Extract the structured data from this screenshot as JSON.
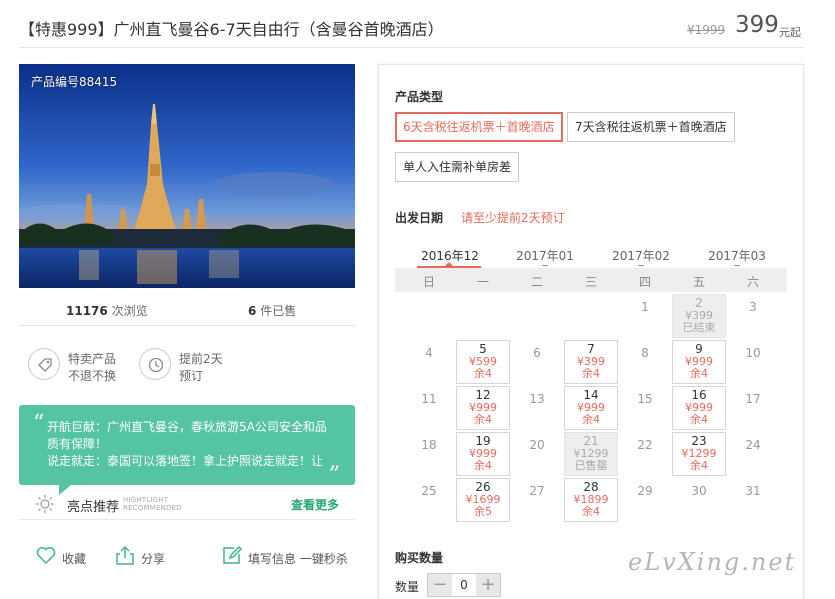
{
  "header": {
    "title": "【特惠999】广州直飞曼谷6-7天自由行（含曼谷首晚酒店）",
    "old_price": "¥1999",
    "price": "399",
    "price_unit": "元起"
  },
  "photo": {
    "product_code": "产品编号88415"
  },
  "stats": {
    "views_count": "11176",
    "views_label": "次浏览",
    "sold_count": "6",
    "sold_label": "件已售"
  },
  "features": [
    {
      "line1": "特卖产品",
      "line2": "不退不换",
      "icon": "tag-icon"
    },
    {
      "line1": "提前2天",
      "line2": "预订",
      "icon": "clock-icon"
    }
  ],
  "promo": {
    "line1": "开航巨献：广州直飞曼谷，春秋旅游5A公司安全和品",
    "line2": "质有保障！",
    "line3": "说走就走：泰国可以落地签！拿上护照说走就走！让"
  },
  "highlight": {
    "title": "亮点推荐",
    "sub1": "HIGHTLIGHT",
    "sub2": "RECOMMENDED",
    "more": "查看更多"
  },
  "actions": {
    "favorite": "收藏",
    "share": "分享",
    "fill_info": "填写信息 一键秒杀"
  },
  "product_type": {
    "title": "产品类型",
    "options": [
      {
        "label": "6天含税往返机票＋首晚酒店",
        "selected": true
      },
      {
        "label": "7天含税往返机票＋首晚酒店",
        "selected": false
      },
      {
        "label": "单人入住需补单房差",
        "selected": false
      }
    ]
  },
  "departure": {
    "title": "出发日期",
    "hint": "请至少提前2天预订",
    "months": [
      "2016年12",
      "2017年01",
      "2017年02",
      "2017年03"
    ],
    "active_month": 0,
    "weekdays": [
      "日",
      "一",
      "二",
      "三",
      "四",
      "五",
      "六"
    ],
    "days": [
      {
        "day": "1",
        "col": 4,
        "row": 0,
        "state": "plain"
      },
      {
        "day": "2",
        "col": 5,
        "row": 0,
        "state": "gone",
        "price": "¥399",
        "status": "已结束"
      },
      {
        "day": "3",
        "col": 6,
        "row": 0,
        "state": "plain"
      },
      {
        "day": "4",
        "col": 0,
        "row": 1,
        "state": "plain"
      },
      {
        "day": "5",
        "col": 1,
        "row": 1,
        "state": "avail",
        "price": "¥599",
        "status": "余4"
      },
      {
        "day": "6",
        "col": 2,
        "row": 1,
        "state": "plain"
      },
      {
        "day": "7",
        "col": 3,
        "row": 1,
        "state": "avail",
        "price": "¥399",
        "status": "余4"
      },
      {
        "day": "8",
        "col": 4,
        "row": 1,
        "state": "plain"
      },
      {
        "day": "9",
        "col": 5,
        "row": 1,
        "state": "avail",
        "price": "¥999",
        "status": "余4"
      },
      {
        "day": "10",
        "col": 6,
        "row": 1,
        "state": "plain"
      },
      {
        "day": "11",
        "col": 0,
        "row": 2,
        "state": "plain"
      },
      {
        "day": "12",
        "col": 1,
        "row": 2,
        "state": "avail",
        "price": "¥999",
        "status": "余4"
      },
      {
        "day": "13",
        "col": 2,
        "row": 2,
        "state": "plain"
      },
      {
        "day": "14",
        "col": 3,
        "row": 2,
        "state": "avail",
        "price": "¥999",
        "status": "余4"
      },
      {
        "day": "15",
        "col": 4,
        "row": 2,
        "state": "plain"
      },
      {
        "day": "16",
        "col": 5,
        "row": 2,
        "state": "avail",
        "price": "¥999",
        "status": "余4"
      },
      {
        "day": "17",
        "col": 6,
        "row": 2,
        "state": "plain"
      },
      {
        "day": "18",
        "col": 0,
        "row": 3,
        "state": "plain"
      },
      {
        "day": "19",
        "col": 1,
        "row": 3,
        "state": "avail",
        "price": "¥999",
        "status": "余4"
      },
      {
        "day": "20",
        "col": 2,
        "row": 3,
        "state": "plain"
      },
      {
        "day": "21",
        "col": 3,
        "row": 3,
        "state": "gone",
        "price": "¥1299",
        "status": "已售罄"
      },
      {
        "day": "22",
        "col": 4,
        "row": 3,
        "state": "plain"
      },
      {
        "day": "23",
        "col": 5,
        "row": 3,
        "state": "avail",
        "price": "¥1299",
        "status": "余4"
      },
      {
        "day": "24",
        "col": 6,
        "row": 3,
        "state": "plain"
      },
      {
        "day": "25",
        "col": 0,
        "row": 4,
        "state": "plain"
      },
      {
        "day": "26",
        "col": 1,
        "row": 4,
        "state": "avail",
        "price": "¥1699",
        "status": "余5"
      },
      {
        "day": "27",
        "col": 2,
        "row": 4,
        "state": "plain"
      },
      {
        "day": "28",
        "col": 3,
        "row": 4,
        "state": "avail",
        "price": "¥1899",
        "status": "余4"
      },
      {
        "day": "29",
        "col": 4,
        "row": 4,
        "state": "plain"
      },
      {
        "day": "30",
        "col": 5,
        "row": 4,
        "state": "plain"
      },
      {
        "day": "31",
        "col": 6,
        "row": 4,
        "state": "plain"
      }
    ]
  },
  "quantity": {
    "title": "购买数量",
    "label": "数量",
    "value": "0",
    "minus": "−",
    "plus": "+"
  },
  "watermark": "eLvXing.net",
  "colors": {
    "accent": "#e36c5e",
    "promo_green": "#55c4a2",
    "link_green": "#2aa775"
  }
}
